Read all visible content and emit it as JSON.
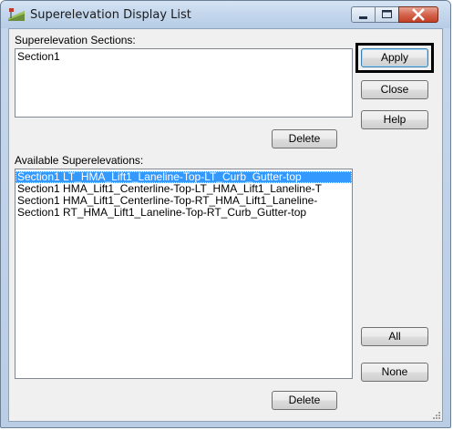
{
  "window": {
    "title": "Superelevation Display List",
    "icons": {
      "app": "superelevation-app-icon",
      "minimize": "minimize-icon",
      "maximize": "maximize-icon",
      "close": "close-icon"
    },
    "colors": {
      "selection": "#3399ff",
      "close_button": "#c9462c",
      "highlight_border": "#000000"
    }
  },
  "sections": {
    "label": "Superelevation Sections:",
    "items": [
      "Section1"
    ],
    "delete_label": "Delete"
  },
  "available": {
    "label": "Available Superelevations:",
    "items": [
      "Section1 LT_HMA_Lift1_Laneline-Top-LT_Curb_Gutter-top",
      "Section1 HMA_Lift1_Centerline-Top-LT_HMA_Lift1_Laneline-T",
      "Section1 HMA_Lift1_Centerline-Top-RT_HMA_Lift1_Laneline-",
      "Section1 RT_HMA_Lift1_Laneline-Top-RT_Curb_Gutter-top"
    ],
    "selected_index": 0,
    "delete_label": "Delete"
  },
  "buttons": {
    "apply": "Apply",
    "close": "Close",
    "help": "Help",
    "all": "All",
    "none": "None"
  }
}
